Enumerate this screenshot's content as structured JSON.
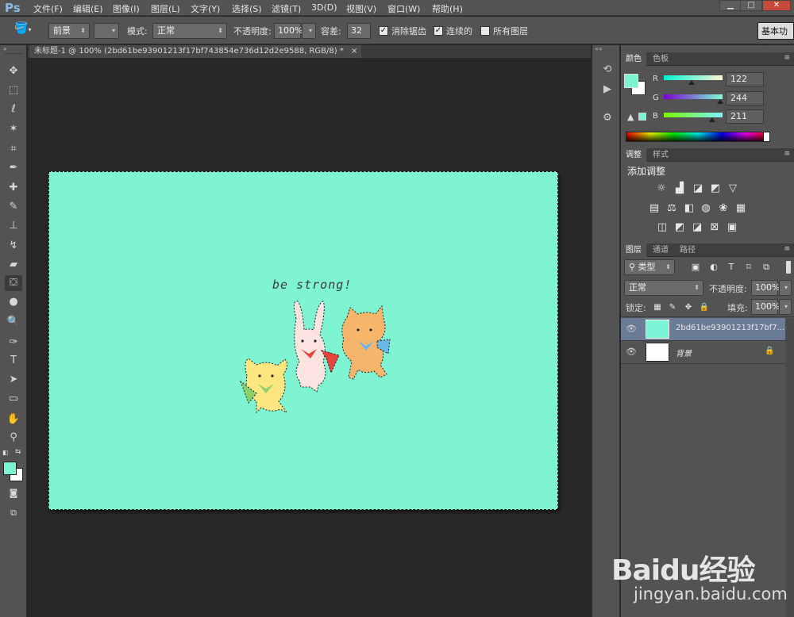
{
  "app": {
    "logo": "Ps",
    "menu": [
      "文件(F)",
      "编辑(E)",
      "图像(I)",
      "图层(L)",
      "文字(Y)",
      "选择(S)",
      "滤镜(T)",
      "3D(D)",
      "视图(V)",
      "窗口(W)",
      "帮助(H)"
    ],
    "window_buttons": {
      "minimize": "▁",
      "restore": "□",
      "close": "✕"
    }
  },
  "options": {
    "fill_source": "前景",
    "mode_label": "模式:",
    "mode_value": "正常",
    "opacity_label": "不透明度:",
    "opacity_value": "100%",
    "tolerance_label": "容差:",
    "tolerance_value": "32",
    "antialias_label": "消除锯齿",
    "antialias_checked": true,
    "contiguous_label": "连续的",
    "contiguous_checked": true,
    "all_layers_label": "所有图层",
    "all_layers_checked": false,
    "workspace_label": "基本功能"
  },
  "document": {
    "tab_title": "未标题-1 @ 100% (2bd61be93901213f17bf743854e736d12d2e9588, RGB/8) *",
    "close_glyph": "×",
    "canvas_color": "#7ef4d3",
    "artwork_text": "be strong!"
  },
  "color_panel": {
    "tabs": [
      "颜色",
      "色板"
    ],
    "fg_color": "#7af4d3",
    "bg_color": "#ffffff",
    "channels": [
      {
        "label": "R",
        "value": "122",
        "fraction": 0.478
      },
      {
        "label": "G",
        "value": "244",
        "fraction": 0.957
      },
      {
        "label": "B",
        "value": "211",
        "fraction": 0.827
      }
    ]
  },
  "adjust_panel": {
    "tabs": [
      "调整",
      "样式"
    ],
    "title": "添加调整"
  },
  "layers_panel": {
    "tabs": [
      "图层",
      "通道",
      "路径"
    ],
    "filter_label": "类型",
    "blend_mode": "正常",
    "opacity_label": "不透明度:",
    "opacity_value": "100%",
    "lock_label": "锁定:",
    "fill_label": "填充:",
    "fill_value": "100%",
    "layers": [
      {
        "name": "2bd61be93901213f17bf7...",
        "selected": true
      },
      {
        "name": "背景",
        "selected": false
      }
    ]
  },
  "watermark": {
    "logo": "Baidu经验",
    "url": "jingyan.baidu.com"
  }
}
